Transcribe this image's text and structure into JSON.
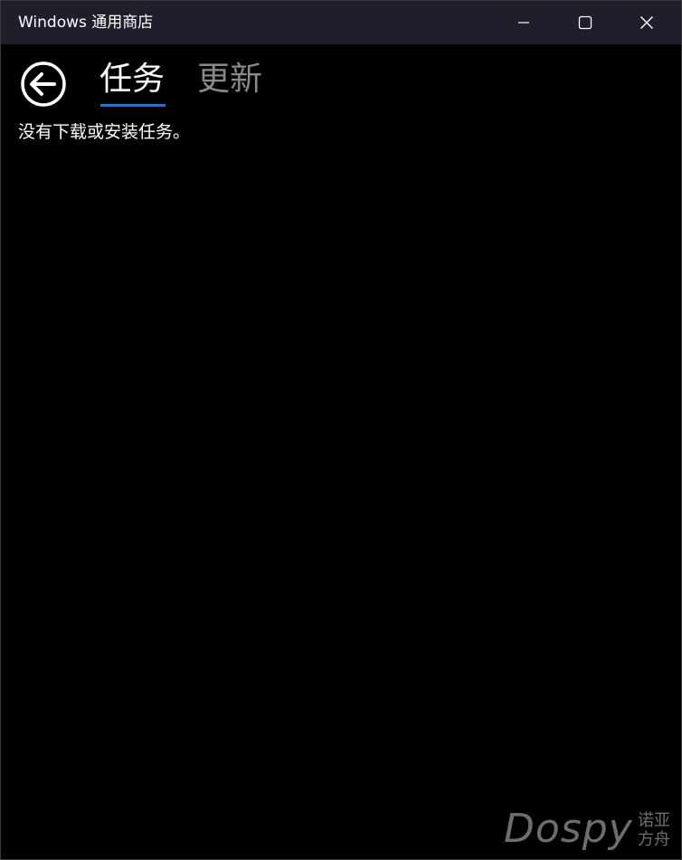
{
  "window": {
    "title": "Windows 通用商店"
  },
  "caption_buttons": {
    "minimize": "minimize-icon",
    "maximize": "maximize-icon",
    "close": "close-icon"
  },
  "nav": {
    "back_icon": "back-arrow-icon",
    "tabs": [
      {
        "label": "任务",
        "selected": true
      },
      {
        "label": "更新",
        "selected": false
      }
    ]
  },
  "content": {
    "empty_message": "没有下载或安装任务。"
  },
  "watermark": {
    "brand": "Dospy",
    "line1": "诺亚",
    "line2": "方舟"
  },
  "colors": {
    "titlebar_bg": "#1f1f2b",
    "content_bg": "#000000",
    "accent": "#2a6ecf",
    "inactive_tab": "#8a8a8a",
    "watermark": "#6e6e6e"
  }
}
